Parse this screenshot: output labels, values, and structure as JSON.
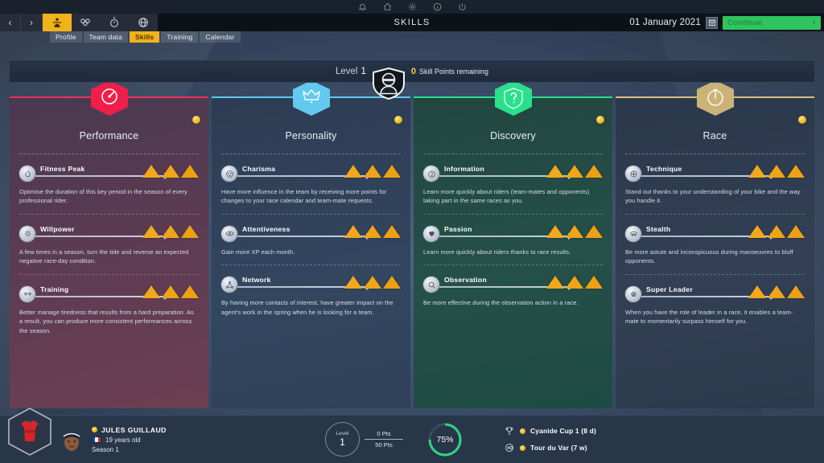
{
  "titlebar": {
    "title": "SKILLS",
    "date": "01 January 2021",
    "calendar_icon": "calendar-icon",
    "continue_label": "Continue",
    "continue_arrow": "›"
  },
  "top_icons": [
    {
      "name": "bell-icon"
    },
    {
      "name": "home-icon"
    },
    {
      "name": "gear-icon"
    },
    {
      "name": "info-icon"
    },
    {
      "name": "power-icon"
    }
  ],
  "navbar": {
    "back_arrow": "‹",
    "forward_arrow": "›",
    "icons": [
      {
        "name": "rider-icon",
        "active": true
      },
      {
        "name": "team-icon",
        "active": false
      },
      {
        "name": "stopwatch-icon",
        "active": false
      },
      {
        "name": "globe-icon",
        "active": false
      }
    ]
  },
  "subtabs": [
    {
      "label": "Profile",
      "active": false
    },
    {
      "label": "Team data",
      "active": false
    },
    {
      "label": "Skills",
      "active": true
    },
    {
      "label": "Training",
      "active": false
    },
    {
      "label": "Calendar",
      "active": false
    }
  ],
  "level_banner": {
    "level_label": "Level",
    "level_value": "1",
    "points_value": "0",
    "points_label": "Skill Points remaining",
    "badge_icon": "rider-shield-badge-icon"
  },
  "columns": [
    {
      "key": "performance",
      "title": "Performance",
      "accent": "#e8315f",
      "hex_color": "#ef1f49",
      "hex_icon": "speedometer-icon",
      "coin": true,
      "skills": [
        {
          "name": "Fitness Peak",
          "icon": "flame-icon",
          "chevrons": 3,
          "description": "Optimise the duration of this key period in the season of every professional rider."
        },
        {
          "name": "Willpower",
          "icon": "gear-circle-icon",
          "chevrons": 3,
          "description": "A few times in a season, turn the tide and reverse an expected negative race-day condition."
        },
        {
          "name": "Training",
          "icon": "dumbbell-icon",
          "chevrons": 3,
          "description": "Better manage tiredness that results from a hard preparation. As a result, you can produce more consistent performances across the season."
        }
      ]
    },
    {
      "key": "personality",
      "title": "Personality",
      "accent": "#5fc8ee",
      "hex_color": "#62c9ef",
      "hex_icon": "crown-icon",
      "coin": true,
      "skills": [
        {
          "name": "Charisma",
          "icon": "smiley-icon",
          "chevrons": 3,
          "description": "Have more influence in the team by receiving more points for changes to your race calendar and team-mate requests."
        },
        {
          "name": "Attentiveness",
          "icon": "eye-icon",
          "chevrons": 3,
          "description": "Gain more XP each month."
        },
        {
          "name": "Network",
          "icon": "network-icon",
          "chevrons": 3,
          "description": "By having more contacts of interest, have greater impact on the agent's work in the spring when he is looking for a team."
        }
      ]
    },
    {
      "key": "discovery",
      "title": "Discovery",
      "accent": "#27e08b",
      "hex_color": "#2ae08c",
      "hex_icon": "question-icon",
      "coin": true,
      "skills": [
        {
          "name": "Information",
          "icon": "question-circle-icon",
          "chevrons": 3,
          "description": "Learn more quickly about riders (team-mates and opponents) taking part in the same races as you."
        },
        {
          "name": "Passion",
          "icon": "heart-icon",
          "chevrons": 3,
          "description": "Learn more quickly about riders thanks to race results."
        },
        {
          "name": "Observation",
          "icon": "magnifier-icon",
          "chevrons": 3,
          "description": "Be more effective during the observation action in a race."
        }
      ]
    },
    {
      "key": "race",
      "title": "Race",
      "accent": "#d8c37e",
      "hex_color": "#cbb377",
      "hex_icon": "stopwatch-icon",
      "coin": true,
      "skills": [
        {
          "name": "Technique",
          "icon": "bike-wheel-icon",
          "chevrons": 3,
          "description": "Stand out thanks to your understanding of your bike and the way you handle it."
        },
        {
          "name": "Stealth",
          "icon": "stealth-icon",
          "chevrons": 3,
          "description": "Be more astute and inconspicuous during manoeuvres to bluff opponents."
        },
        {
          "name": "Super Leader",
          "icon": "medal-icon",
          "chevrons": 3,
          "description": "When you have the role of leader in a race, it enables a team-mate to momentarily surpass himself for you."
        }
      ]
    }
  ],
  "bottom": {
    "jersey_icon": "jersey-hex-icon",
    "avatar": "rider-portrait",
    "rider_name": "JULES GUILLAUD",
    "rider_age": "19 years old",
    "season": "Season 1",
    "flag": "france-flag-icon",
    "level_label": "Level",
    "level_value": "1",
    "points_current": "0 Pts",
    "points_total": "50 Pts",
    "percent": "75%",
    "percent_value": 75,
    "races": [
      {
        "icon": "trophy-icon",
        "label": "Cyanide Cup 1 (8 d)"
      },
      {
        "icon": "hd-icon",
        "label": "Tour du Var (7 w)"
      }
    ]
  },
  "colors": {
    "accent_yellow": "#f2b21a",
    "continue_green": "#2fc45f",
    "chevron_orange": "#f2a81c",
    "ring_green": "#2fd67f"
  }
}
